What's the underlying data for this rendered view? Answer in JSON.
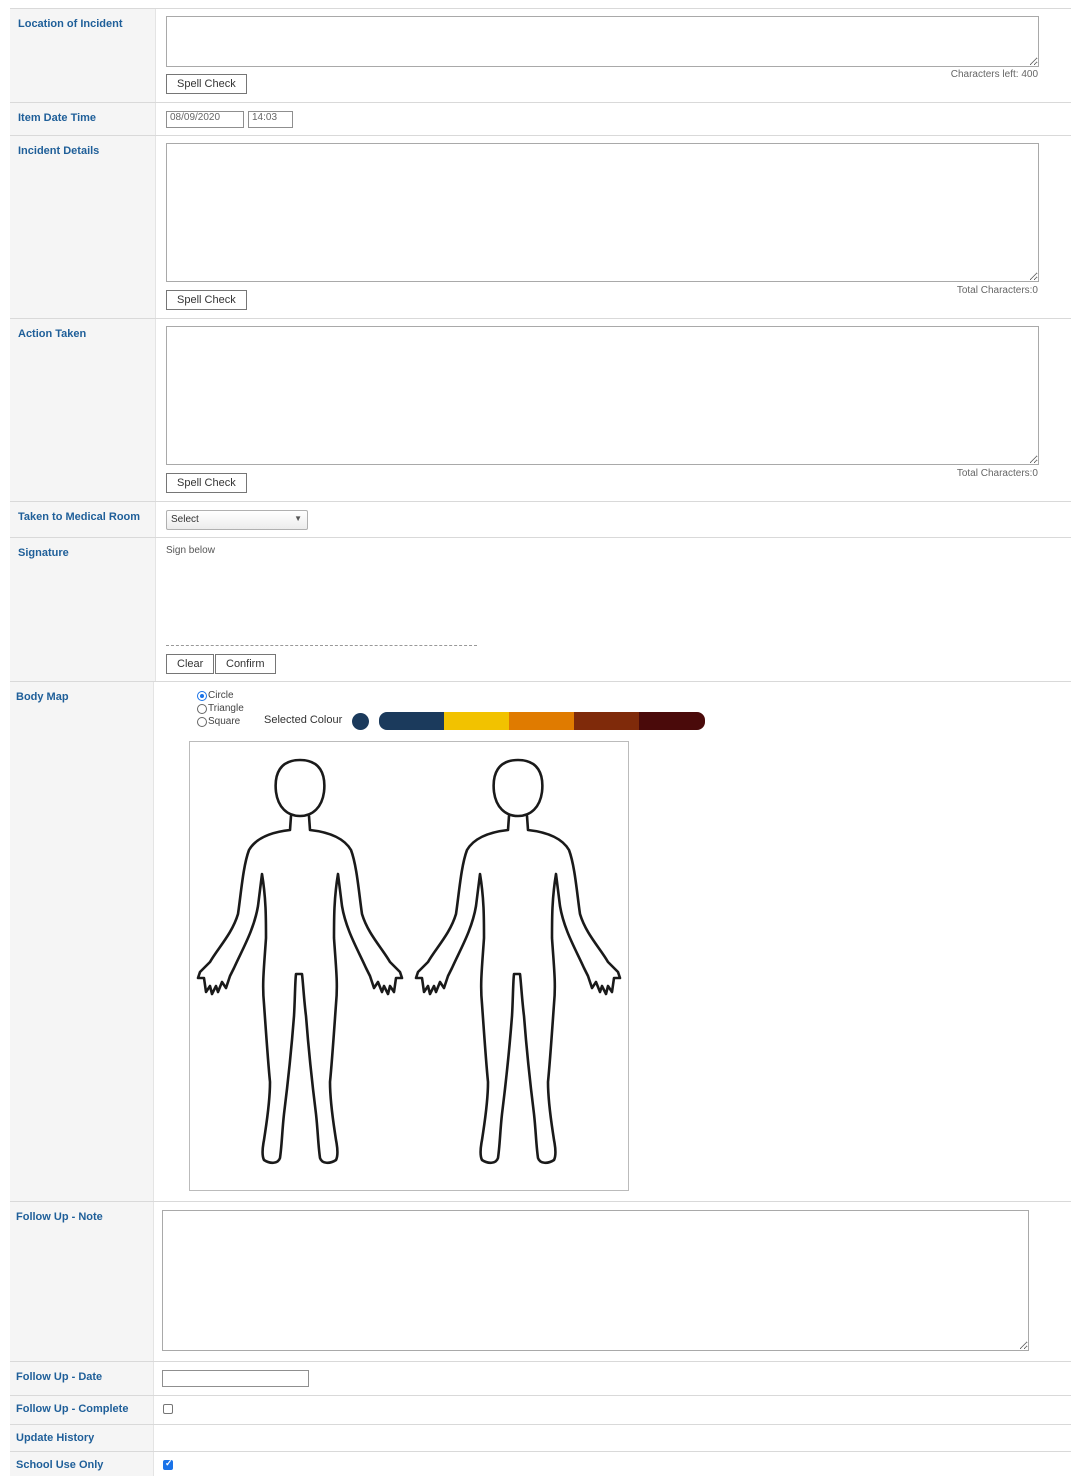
{
  "location": {
    "label": "Location of Incident",
    "value": "",
    "spell_check": "Spell Check",
    "counter": "Characters left: 400"
  },
  "item_date_time": {
    "label": "Item Date Time",
    "date": "08/09/2020",
    "time": "14:03"
  },
  "incident_details": {
    "label": "Incident Details",
    "value": "",
    "spell_check": "Spell Check",
    "counter": "Total Characters:0"
  },
  "action_taken": {
    "label": "Action Taken",
    "value": "",
    "spell_check": "Spell Check",
    "counter": "Total Characters:0"
  },
  "medical_room": {
    "label": "Taken to Medical Room",
    "selected": "Select"
  },
  "signature": {
    "label": "Signature",
    "hint": "Sign below",
    "clear": "Clear",
    "confirm": "Confirm"
  },
  "body_map": {
    "label": "Body Map",
    "shapes": [
      "Circle",
      "Triangle",
      "Square"
    ],
    "selected_shape": "Circle",
    "selected_colour_label": "Selected Colour",
    "selected_colour": "#1b3a5c",
    "palette": [
      "#1b3a5c",
      "#f2c200",
      "#e07b00",
      "#7f2a0a",
      "#4a0a0a"
    ]
  },
  "follow_up_note": {
    "label": "Follow Up - Note",
    "value": ""
  },
  "follow_up_date": {
    "label": "Follow Up - Date",
    "value": ""
  },
  "follow_up_complete": {
    "label": "Follow Up - Complete",
    "checked": false
  },
  "update_history": {
    "label": "Update History"
  },
  "school_use_only": {
    "label": "School Use Only",
    "checked": true
  }
}
